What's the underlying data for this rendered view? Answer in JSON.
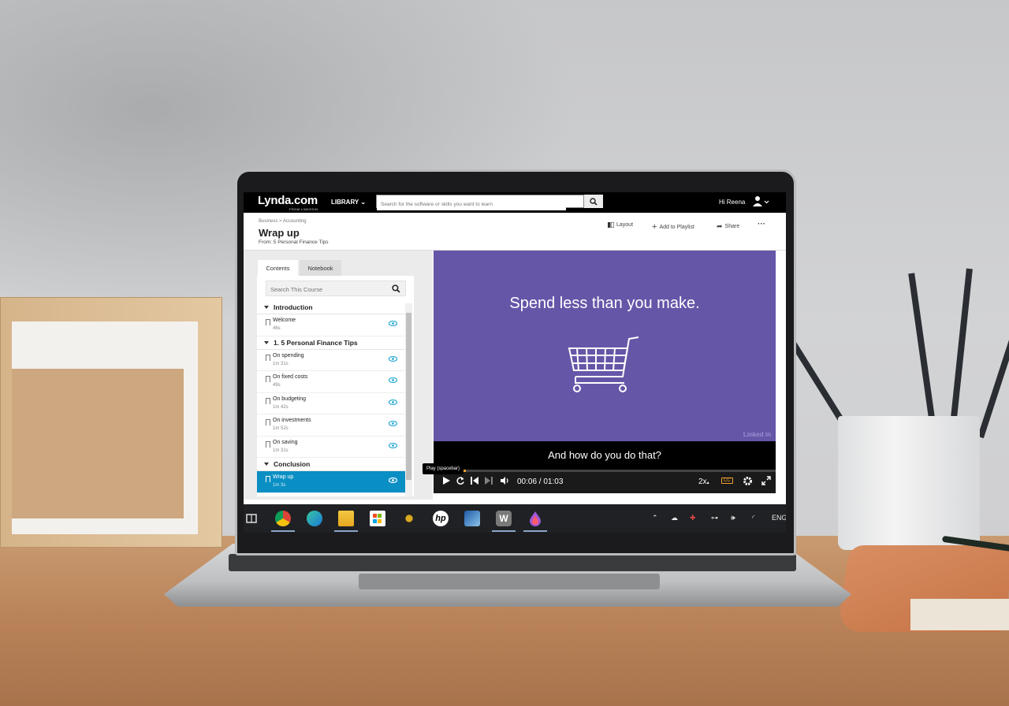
{
  "app": {
    "logo": "Lynda.com",
    "logo_sub": "FROM LINKEDIN",
    "library_label": "LIBRARY",
    "search_placeholder": "Search for the software or skills you want to learn",
    "greeting": "Hi Reena"
  },
  "header": {
    "breadcrumb": "Business > Accounting",
    "title": "Wrap up",
    "from_line": "From: 5 Personal Finance Tips",
    "actions": {
      "layout": "Layout",
      "add_to_playlist": "Add to Playlist",
      "share": "Share",
      "more": "···"
    }
  },
  "sidebar": {
    "tabs": [
      "Contents",
      "Notebook"
    ],
    "active_tab": "Contents",
    "search_placeholder": "Search This Course",
    "sections": [
      {
        "title": "Introduction",
        "items": [
          {
            "title": "Welcome",
            "duration": "46s"
          }
        ]
      },
      {
        "title": "1. 5 Personal Finance Tips",
        "items": [
          {
            "title": "On spending",
            "duration": "1m 31s"
          },
          {
            "title": "On fixed costs",
            "duration": "49s"
          },
          {
            "title": "On budgeting",
            "duration": "1m 42s"
          },
          {
            "title": "On investments",
            "duration": "1m 52s"
          },
          {
            "title": "On saving",
            "duration": "1m 31s"
          }
        ]
      },
      {
        "title": "Conclusion",
        "items": [
          {
            "title": "Wrap up",
            "duration": "1m 3s",
            "active": true
          }
        ]
      }
    ]
  },
  "video": {
    "slide_text": "Spend less than you make.",
    "brand": "Linked in",
    "caption": "And how do you do that?",
    "tooltip": "Play (spacebar)",
    "time": "00:06 / 01:03",
    "progress_fraction": 0.095,
    "speed": "2x",
    "cc": "CC"
  },
  "taskbar": {
    "language": "ENG",
    "accent": "#0a8fc4",
    "video_bg": "#6656a8",
    "progress_color": "#f2a230"
  }
}
